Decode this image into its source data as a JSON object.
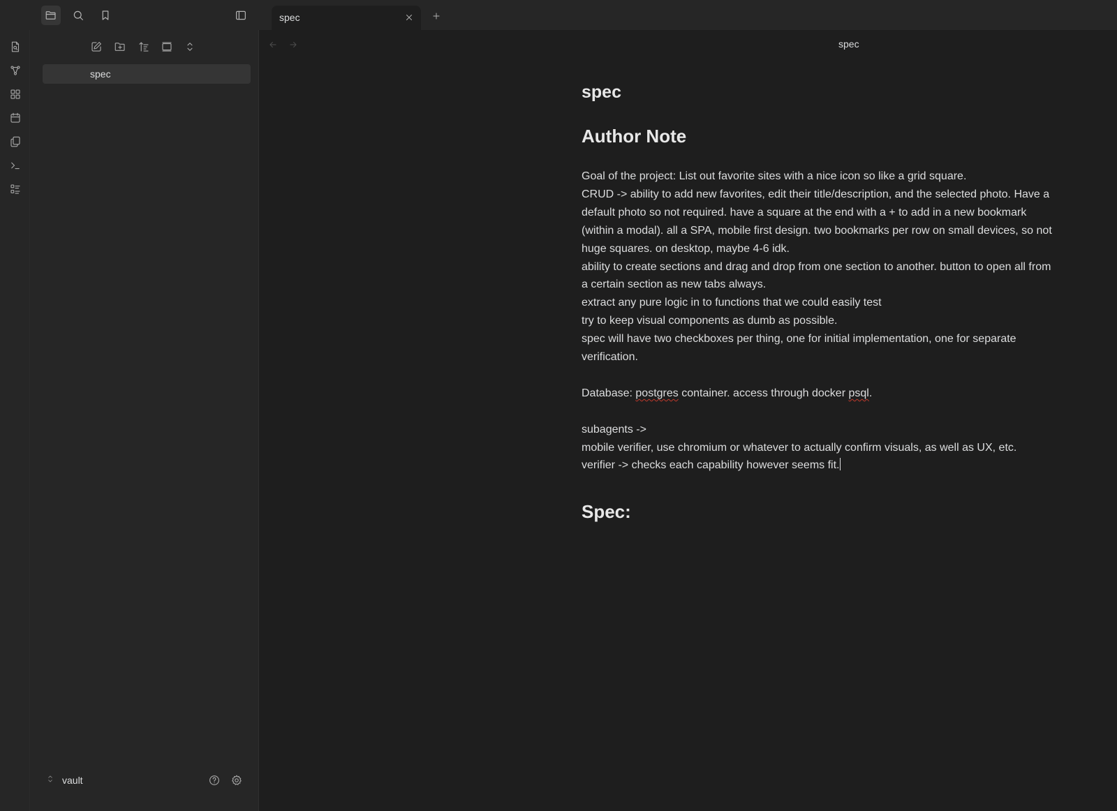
{
  "topbar": {
    "icons": [
      "folder-icon",
      "search-icon",
      "bookmark-icon",
      "sidebar-toggle-icon"
    ]
  },
  "tab": {
    "label": "spec",
    "close_icon": "close-icon",
    "new_tab_icon": "plus-icon"
  },
  "ribbon": {
    "icons": [
      "open-quick-switcher-icon",
      "graph-view-icon",
      "canvas-icon",
      "daily-note-icon",
      "templates-icon",
      "command-palette-icon",
      "outline-icon"
    ]
  },
  "sidebar": {
    "tools": [
      "new-note-icon",
      "new-folder-icon",
      "sort-icon",
      "collapse-icon",
      "expand-collapse-icon"
    ],
    "files": [
      {
        "name": "spec"
      }
    ],
    "vault_name": "vault",
    "help_icon": "help-icon",
    "settings_icon": "settings-icon"
  },
  "editor": {
    "view_title": "spec",
    "doc_title": "spec",
    "heading_note": "Author Note",
    "lines": [
      "Goal of the project: List out favorite sites with a nice icon so like a grid square.",
      "CRUD -> ability to add new favorites, edit their title/description, and the selected photo. Have a",
      "default photo so not required. have a square at the end with a + to add in a new bookmark",
      "(within a modal). all a SPA, mobile first design. two bookmarks per row on small devices, so not",
      "huge squares. on desktop, maybe 4-6 idk.",
      "ability to create sections and drag and drop from one section to another. button to open all from",
      "a certain section as new tabs always.",
      "extract any pure logic in to functions that we could easily test",
      "try to keep visual components as dumb as possible.",
      "spec will have two checkboxes per thing, one for initial implementation, one for separate",
      "verification."
    ],
    "db_prefix": "Database: ",
    "db_word1": "postgres",
    "db_mid": " container. access through docker ",
    "db_word2": "psql",
    "db_suffix": ".",
    "subagents": "subagents ->",
    "mobile_verifier": "mobile verifier, use chromium or whatever to actually confirm visuals, as well as UX, etc.",
    "verifier": "verifier -> checks each capability however seems fit.",
    "heading_spec": "Spec:"
  }
}
